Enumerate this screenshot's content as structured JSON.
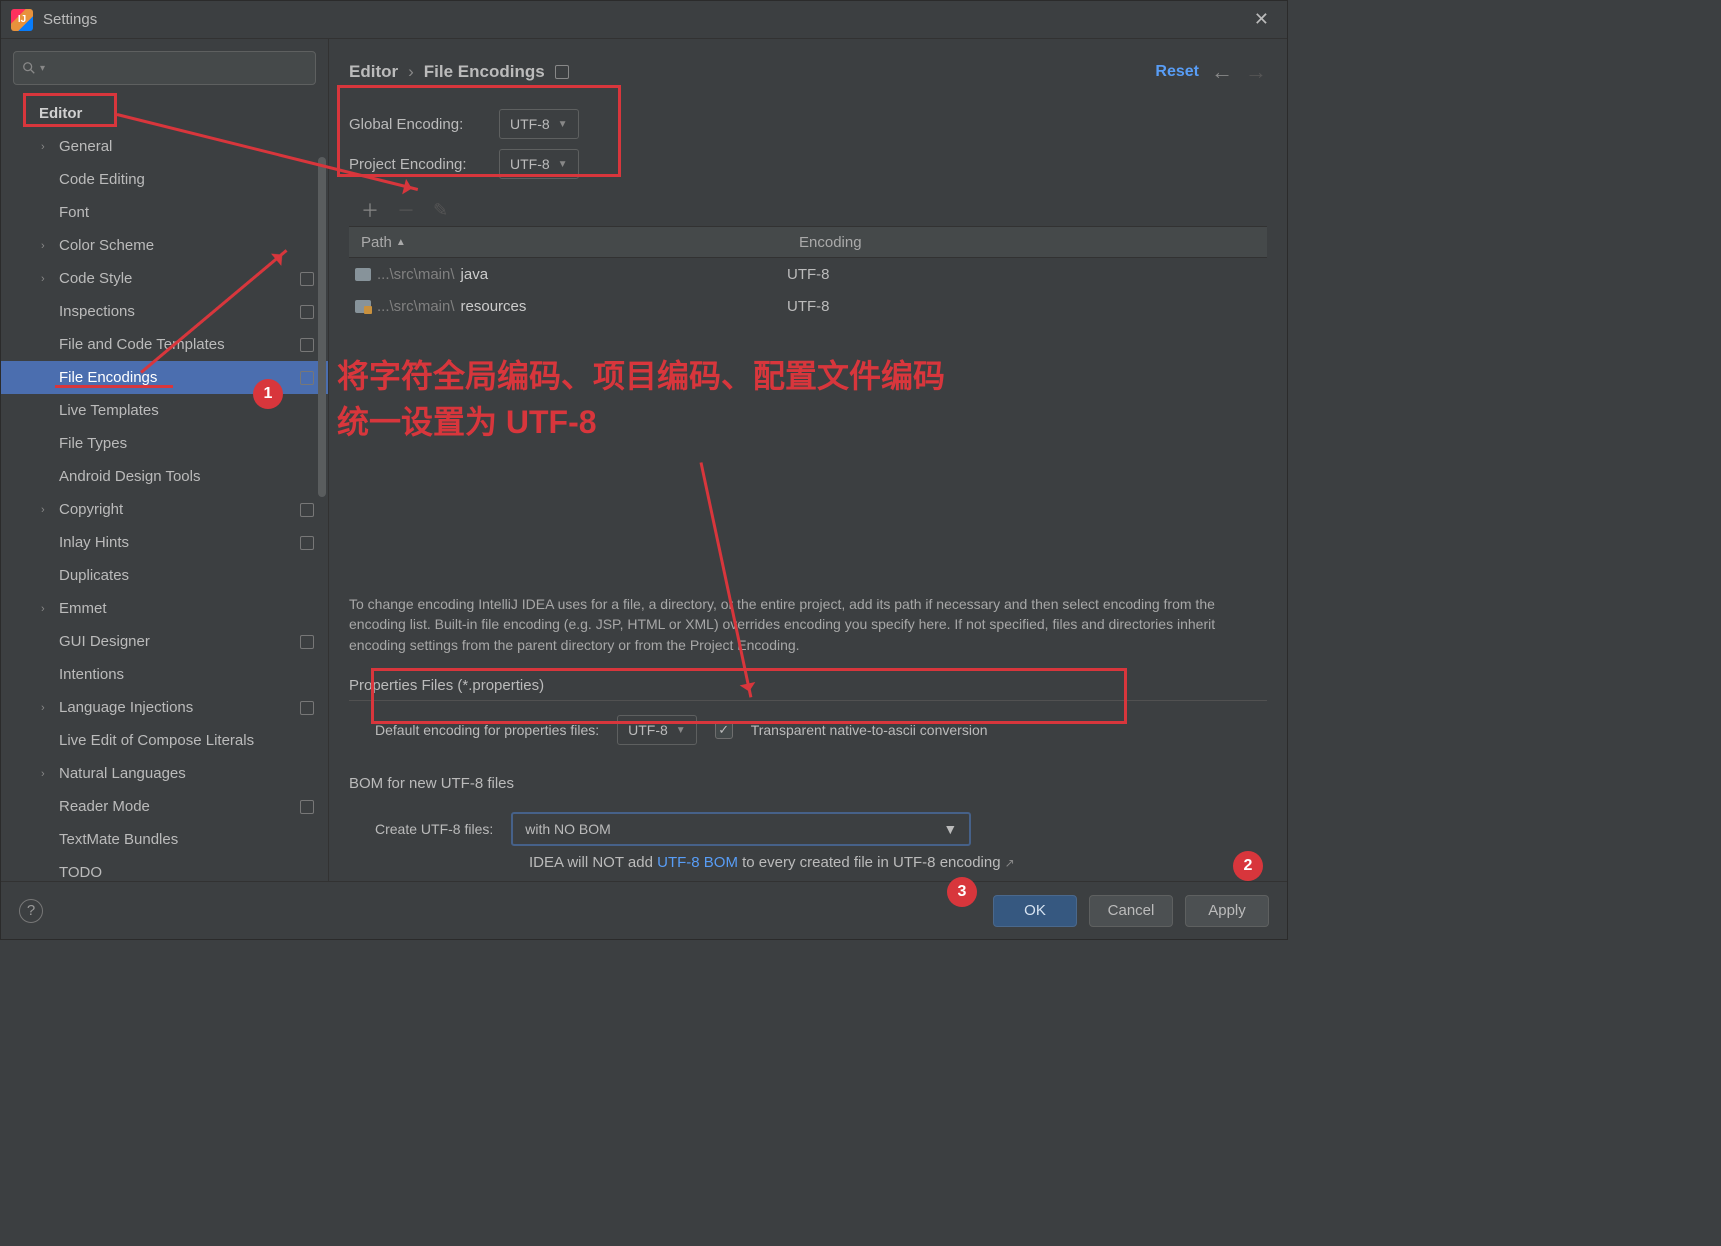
{
  "window": {
    "title": "Settings"
  },
  "breadcrumb": {
    "root": "Editor",
    "leaf": "File Encodings"
  },
  "actions": {
    "reset": "Reset"
  },
  "sidebar": {
    "root": "Editor",
    "items": [
      {
        "label": "General",
        "exp": true,
        "gear": false
      },
      {
        "label": "Code Editing",
        "exp": false,
        "gear": false
      },
      {
        "label": "Font",
        "exp": false,
        "gear": false
      },
      {
        "label": "Color Scheme",
        "exp": true,
        "gear": false
      },
      {
        "label": "Code Style",
        "exp": true,
        "gear": true
      },
      {
        "label": "Inspections",
        "exp": false,
        "gear": true
      },
      {
        "label": "File and Code Templates",
        "exp": false,
        "gear": true
      },
      {
        "label": "File Encodings",
        "exp": false,
        "gear": true,
        "selected": true
      },
      {
        "label": "Live Templates",
        "exp": false,
        "gear": false
      },
      {
        "label": "File Types",
        "exp": false,
        "gear": false
      },
      {
        "label": "Android Design Tools",
        "exp": false,
        "gear": false
      },
      {
        "label": "Copyright",
        "exp": true,
        "gear": true
      },
      {
        "label": "Inlay Hints",
        "exp": false,
        "gear": true
      },
      {
        "label": "Duplicates",
        "exp": false,
        "gear": false
      },
      {
        "label": "Emmet",
        "exp": true,
        "gear": false
      },
      {
        "label": "GUI Designer",
        "exp": false,
        "gear": true
      },
      {
        "label": "Intentions",
        "exp": false,
        "gear": false
      },
      {
        "label": "Language Injections",
        "exp": true,
        "gear": true
      },
      {
        "label": "Live Edit of Compose Literals",
        "exp": false,
        "gear": false
      },
      {
        "label": "Natural Languages",
        "exp": true,
        "gear": false
      },
      {
        "label": "Reader Mode",
        "exp": false,
        "gear": true
      },
      {
        "label": "TextMate Bundles",
        "exp": false,
        "gear": false
      },
      {
        "label": "TODO",
        "exp": false,
        "gear": false
      }
    ]
  },
  "encodings": {
    "global_label": "Global Encoding:",
    "global_value": "UTF-8",
    "project_label": "Project Encoding:",
    "project_value": "UTF-8"
  },
  "table": {
    "col_path": "Path",
    "col_enc": "Encoding",
    "rows": [
      {
        "prefix": "...\\src\\main\\",
        "bold": "java",
        "enc": "UTF-8",
        "iconOrange": false
      },
      {
        "prefix": "...\\src\\main\\",
        "bold": "resources",
        "enc": "UTF-8",
        "iconOrange": true
      }
    ]
  },
  "help_text": "To change encoding IntelliJ IDEA uses for a file, a directory, or the entire project, add its path if necessary and then select encoding from the encoding list. Built-in file encoding (e.g. JSP, HTML or XML) overrides encoding you specify here. If not specified, files and directories inherit encoding settings from the parent directory or from the Project Encoding.",
  "properties": {
    "section": "Properties Files (*.properties)",
    "label": "Default encoding for properties files:",
    "value": "UTF-8",
    "check_label": "Transparent native-to-ascii conversion"
  },
  "bom": {
    "section": "BOM for new UTF-8 files",
    "label": "Create UTF-8 files:",
    "value": "with NO BOM",
    "hint_pre": "IDEA will NOT add ",
    "hint_link": "UTF-8 BOM",
    "hint_post": " to every created file in UTF-8 encoding"
  },
  "footer": {
    "ok": "OK",
    "cancel": "Cancel",
    "apply": "Apply"
  },
  "annotations": {
    "text_line1": "将字符全局编码、项目编码、配置文件编码",
    "text_line2": "统一设置为 UTF-8",
    "n1": "1",
    "n2": "2",
    "n3": "3"
  }
}
